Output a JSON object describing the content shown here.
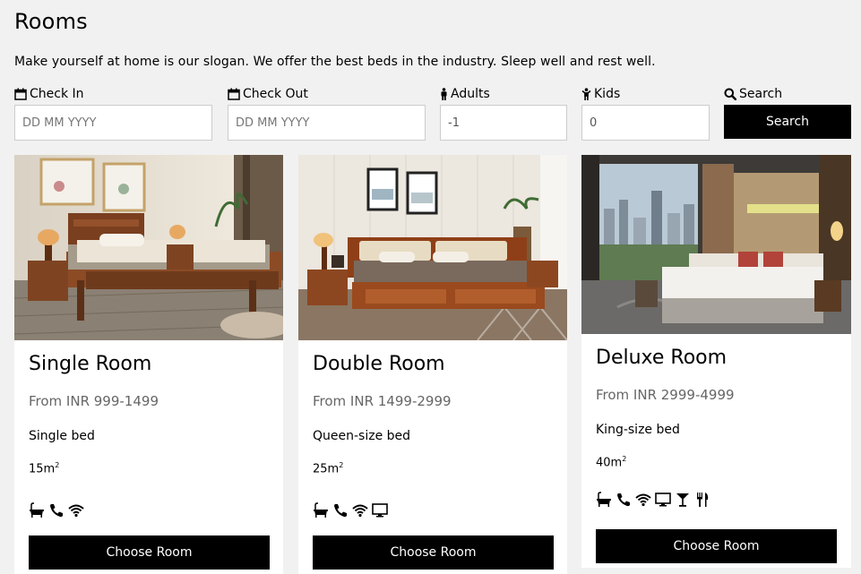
{
  "page": {
    "title": "Rooms",
    "slogan": "Make yourself at home is our slogan. We offer the best beds in the industry. Sleep well and rest well."
  },
  "search": {
    "check_in": {
      "label": "Check In",
      "placeholder": "DD MM YYYY",
      "value": ""
    },
    "check_out": {
      "label": "Check Out",
      "placeholder": "DD MM YYYY",
      "value": ""
    },
    "adults": {
      "label": "Adults",
      "value": "-1"
    },
    "kids": {
      "label": "Kids",
      "value": "0"
    },
    "search_label": "Search",
    "button_label": "Search"
  },
  "rooms": [
    {
      "name": "Single Room",
      "price": "From INR 999-1499",
      "bed": "Single bed",
      "size": "15m",
      "size_unit_sup": "2",
      "amenities": [
        "bath-icon",
        "phone-icon",
        "wifi-icon"
      ],
      "button": "Choose Room"
    },
    {
      "name": "Double Room",
      "price": "From INR 1499-2999",
      "bed": "Queen-size bed",
      "size": "25m",
      "size_unit_sup": "2",
      "amenities": [
        "bath-icon",
        "phone-icon",
        "wifi-icon",
        "tv-icon"
      ],
      "button": "Choose Room"
    },
    {
      "name": "Deluxe Room",
      "price": "From INR 2999-4999",
      "bed": "King-size bed",
      "size": "40m",
      "size_unit_sup": "2",
      "amenities": [
        "bath-icon",
        "phone-icon",
        "wifi-icon",
        "tv-icon",
        "cocktail-icon",
        "cutlery-icon"
      ],
      "button": "Choose Room"
    }
  ]
}
